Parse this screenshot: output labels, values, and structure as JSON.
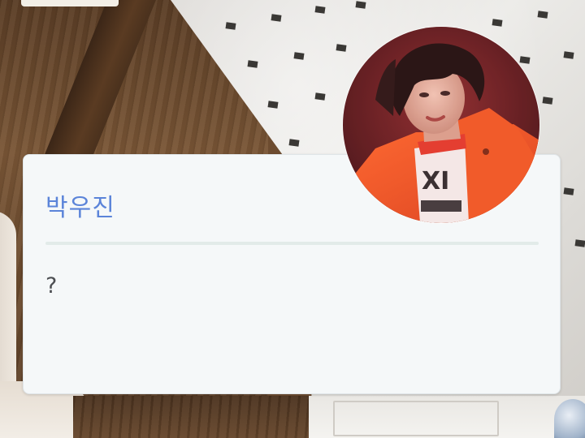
{
  "profile": {
    "name": "박우진",
    "message": "?",
    "avatar_alt": "profile-photo"
  },
  "colors": {
    "name_text": "#5b84d9",
    "card_bg": "#f5f8f9",
    "divider": "#e2ebe9",
    "message_text": "#4c4e52"
  }
}
